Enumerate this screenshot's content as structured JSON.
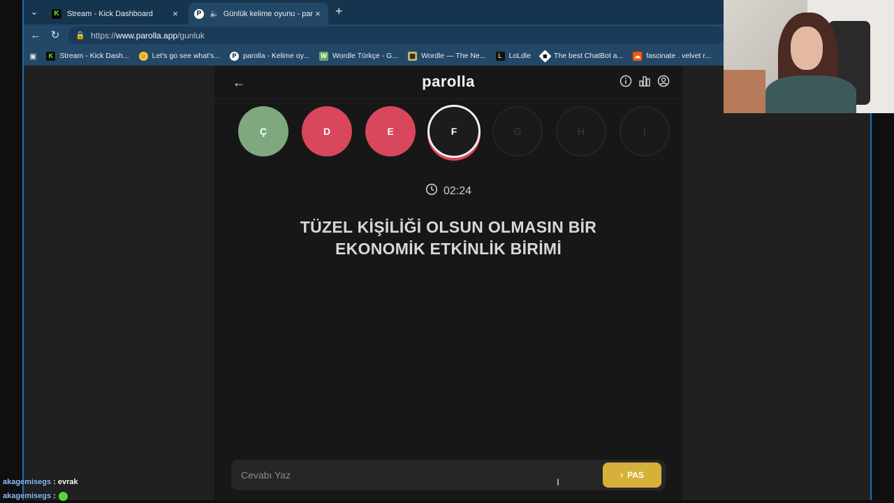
{
  "browser": {
    "tabs": [
      {
        "label": "Stream - Kick Dashboard",
        "icon": "kick-icon",
        "color": "#53fc18"
      },
      {
        "label": "Günlük kelime oyunu - parolla",
        "icon": "parolla-icon",
        "active": true
      }
    ],
    "url": {
      "prefix": "https://",
      "host": "www.parolla.app",
      "path": "/gunluk"
    },
    "bookmarks": [
      {
        "label": "Stream - Kick Dash...",
        "icon": "kick-icon"
      },
      {
        "label": "Let's go see what's...",
        "icon": "emoji-icon"
      },
      {
        "label": "parolla - Kelime oy...",
        "icon": "parolla-icon"
      },
      {
        "label": "Wordle Türkçe - G...",
        "icon": "wordle-tr-icon"
      },
      {
        "label": "Wordle — The Ne...",
        "icon": "wordle-grid-icon"
      },
      {
        "label": "LoLdle",
        "icon": "loldle-icon"
      },
      {
        "label": "The best ChatBot a...",
        "icon": "chatbot-icon"
      },
      {
        "label": "fascinate . velvet r...",
        "icon": "soundcloud-icon"
      }
    ]
  },
  "app": {
    "logo": "parolla",
    "letters": [
      {
        "letter": "Ç",
        "state": "correct"
      },
      {
        "letter": "D",
        "state": "wrong"
      },
      {
        "letter": "E",
        "state": "wrong"
      },
      {
        "letter": "F",
        "state": "active"
      },
      {
        "letter": "G",
        "state": "pending"
      },
      {
        "letter": "H",
        "state": "pending"
      },
      {
        "letter": "I",
        "state": "pending"
      }
    ],
    "timer": "02:24",
    "question": "TÜZEL KİŞİLİĞİ OLSUN OLMASIN BİR EKONOMİK ETKİNLİK BİRİMİ",
    "answer_placeholder": "Cevabı Yaz",
    "pass_label": "PAS"
  },
  "chat": [
    {
      "user": "akagemisegs",
      "message": "evrak"
    },
    {
      "user": "akagemisegs",
      "message": ""
    }
  ],
  "colors": {
    "correct": "#7fa87f",
    "wrong": "#d9475c",
    "accent": "#d6b13a",
    "chrome": "#234767"
  }
}
